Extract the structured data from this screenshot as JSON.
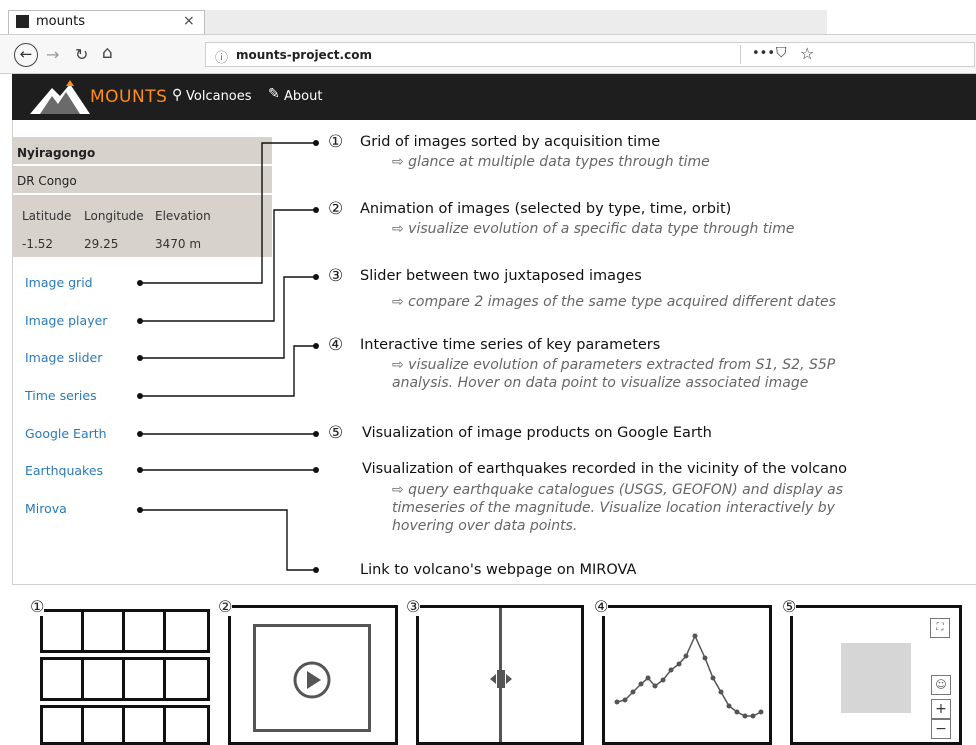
{
  "browser": {
    "tab_title": "mounts",
    "tab_close": "×",
    "url": "mounts-project.com",
    "icons": [
      "back-arrow-icon",
      "forward-arrow-icon",
      "reload-icon",
      "home-icon",
      "info-icon",
      "more-icon",
      "pocket-icon",
      "star-icon"
    ]
  },
  "site": {
    "brand": "MOUNTS",
    "brand_color": "#ff8c1a",
    "nav": {
      "volcanoes": "Volcanoes",
      "about": "About"
    }
  },
  "volcano": {
    "name": "Nyiragongo",
    "country": "DR Congo",
    "headers": {
      "lat": "Latitude",
      "lon": "Longitude",
      "elev": "Elevation"
    },
    "values": {
      "lat": "-1.52",
      "lon": "29.25",
      "elev": "3470 m"
    }
  },
  "sidebar": {
    "links": [
      "Image grid",
      "Image player",
      "Image slider",
      "Time series",
      "Google Earth",
      "Earthquakes",
      "Mirova"
    ]
  },
  "annotations": [
    {
      "num": "①",
      "title": "Grid of images sorted by acquisition time",
      "sub1": "⇨ glance at multiple data types through time",
      "sub2": "",
      "sub3": ""
    },
    {
      "num": "②",
      "title": "Animation of images (selected by type, time, orbit)",
      "sub1": "⇨ visualize evolution of a specific data type through time",
      "sub2": "",
      "sub3": ""
    },
    {
      "num": "③",
      "title": "Slider between two juxtaposed images",
      "sub1": "⇨ compare 2 images of the same type acquired different dates",
      "sub2": "",
      "sub3": ""
    },
    {
      "num": "④",
      "title": "Interactive time series of key parameters",
      "sub1": "⇨ visualize evolution of parameters extracted from S1, S2, S5P",
      "sub2": "analysis. Hover on data point to visualize associated image",
      "sub3": ""
    },
    {
      "num": "⑤",
      "title": "Visualization of image products on Google Earth",
      "sub1": "",
      "sub2": "",
      "sub3": ""
    },
    {
      "num": "",
      "title": "Visualization of earthquakes recorded in the vicinity of the volcano",
      "sub1": "⇨ query earthquake catalogues (USGS, GEOFON) and display as",
      "sub2": "timeseries of the magnitude. Visualize location interactively by",
      "sub3": "hovering over data points."
    },
    {
      "num": "",
      "title": "Link to volcano's webpage on MIROVA",
      "sub1": "",
      "sub2": "",
      "sub3": ""
    }
  ],
  "panels": {
    "numbers": [
      "①",
      "②",
      "③",
      "④",
      "⑤"
    ],
    "map_controls": {
      "fullscreen": "⛶",
      "zoom_in": "+",
      "zoom_out": "−"
    }
  }
}
